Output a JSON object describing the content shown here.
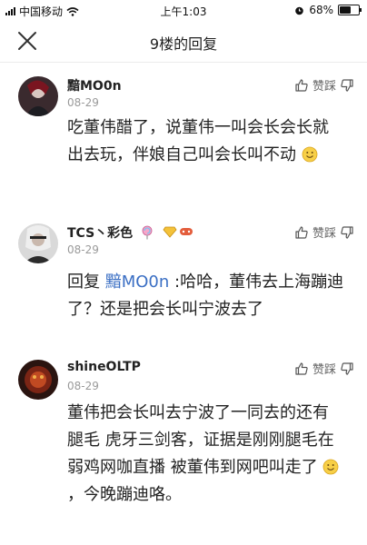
{
  "status_bar": {
    "carrier": "中国移动",
    "time": "上午1:03",
    "battery": "68%",
    "battery_level": 0.68
  },
  "nav": {
    "title": "9楼的回复"
  },
  "comments": [
    {
      "username": "黯MO0n",
      "date": "08-29",
      "action_label": "赞踩",
      "text": "吃董伟醋了，说董伟一叫会长会长就出去玩，伴娘自己叫会长叫不动"
    },
    {
      "username": "TCS丶彩色",
      "date": "08-29",
      "action_label": "赞踩",
      "reply_prefix": "回复 ",
      "mention": "黯MO0n",
      "text": " :哈哈，董伟去上海蹦迪了？还是把会长叫宁波去了"
    },
    {
      "username": "shineOLTP",
      "date": "08-29",
      "action_label": "赞踩",
      "text_part1": "董伟把会长叫去宁波了一同去的还有腿毛 虎牙三剑客，证据是刚刚腿毛在弱鸡网咖直播 被董伟到网吧叫走了",
      "text_part2": "，今晚蹦迪咯。"
    }
  ],
  "icons": {
    "close": "close-icon",
    "like": "thumbs-up-icon",
    "dislike": "thumbs-down-icon",
    "emoji": "smiley-emoji-icon"
  }
}
